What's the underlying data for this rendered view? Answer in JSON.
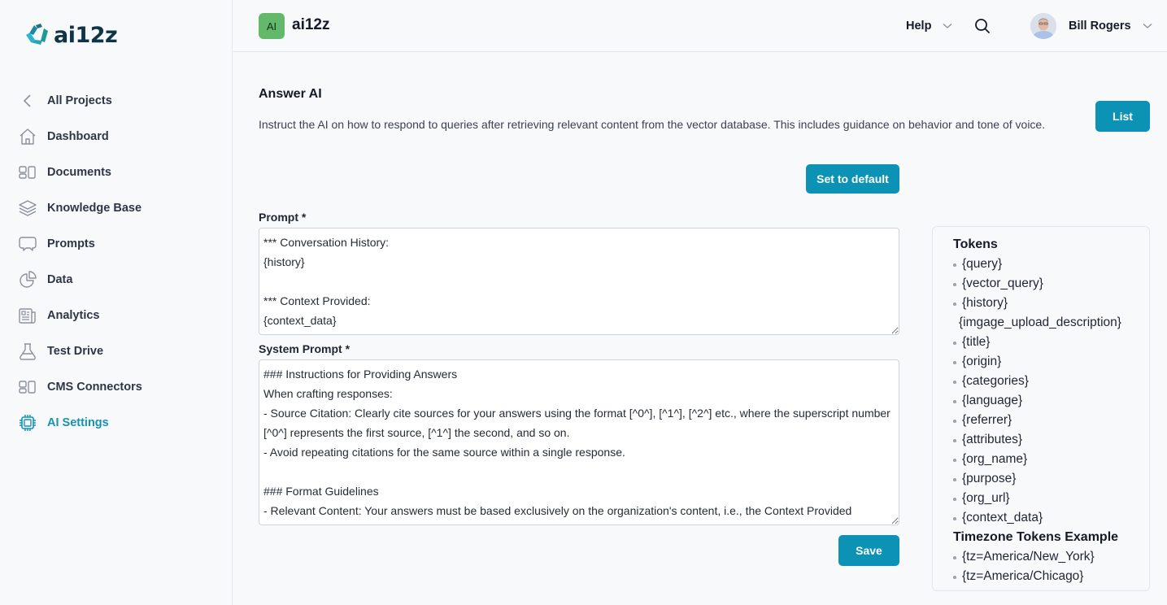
{
  "brand": {
    "name": "ai12z"
  },
  "sidebar": {
    "items": [
      {
        "label": "All Projects",
        "icon": "chevron-left-icon"
      },
      {
        "label": "Dashboard",
        "icon": "home-icon"
      },
      {
        "label": "Documents",
        "icon": "documents-icon"
      },
      {
        "label": "Knowledge Base",
        "icon": "layers-icon"
      },
      {
        "label": "Prompts",
        "icon": "chat-bubbles-icon"
      },
      {
        "label": "Data",
        "icon": "pie-chart-icon"
      },
      {
        "label": "Analytics",
        "icon": "newspaper-icon"
      },
      {
        "label": "Test Drive",
        "icon": "flask-icon"
      },
      {
        "label": "CMS Connectors",
        "icon": "connectors-icon"
      },
      {
        "label": "AI Settings",
        "icon": "chip-icon",
        "active": true
      }
    ]
  },
  "header": {
    "project_badge": "AI",
    "project_name": "ai12z",
    "help_label": "Help",
    "user_name": "Bill Rogers"
  },
  "main": {
    "title": "Answer AI",
    "description": "Instruct the AI on how to respond to queries after retrieving relevant content from the vector database. This includes guidance on behavior and tone of voice.",
    "list_button": "List",
    "default_button": "Set to default",
    "prompt_label": "Prompt *",
    "prompt_value": "*** Conversation History:\n{history}\n\n*** Context Provided:\n{context_data}",
    "system_prompt_label": "System Prompt *",
    "system_prompt_value": "### Instructions for Providing Answers\nWhen crafting responses:\n- Source Citation: Clearly cite sources for your answers using the format [^0^], [^1^], [^2^] etc., where the superscript number [^0^] represents the first source, [^1^] the second, and so on.\n- Avoid repeating citations for the same source within a single response.\n\n### Format Guidelines\n- Relevant Content: Your answers must be based exclusively on the organization's content, i.e., the Context Provided",
    "save_button": "Save"
  },
  "tokens_panel": {
    "tokens_title": "Tokens",
    "tokens": [
      "{query}",
      "{vector_query}",
      "{history}",
      "{imgage_upload_description}",
      "{title}",
      "{origin}",
      "{categories}",
      "{language}",
      "{referrer}",
      "{attributes}",
      "{org_name}",
      "{purpose}",
      "{org_url}",
      "{context_data}"
    ],
    "timezone_title": "Timezone Tokens Example",
    "timezone_tokens": [
      "{tz=America/New_York}",
      "{tz=America/Chicago}"
    ]
  },
  "colors": {
    "accent": "#0b92b4",
    "active_nav": "#1692b4",
    "project_badge": "#63b86a"
  }
}
